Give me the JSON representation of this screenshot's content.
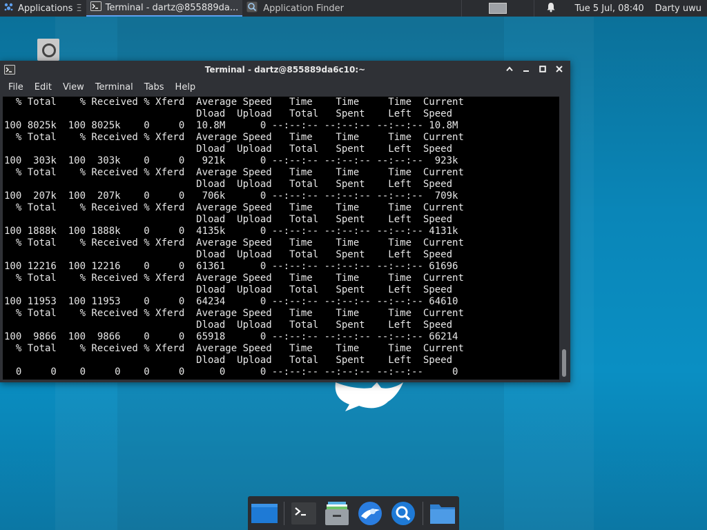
{
  "top_panel": {
    "applications_label": "Applications",
    "tasks": [
      {
        "label": "Terminal - dartz@855889da...",
        "active": true
      },
      {
        "label": "Application Finder",
        "active": false
      }
    ],
    "clock": "Tue  5 Jul, 08:40",
    "user": "Darty uwu"
  },
  "window": {
    "title": "Terminal - dartz@855889da6c10:~",
    "menus": [
      "File",
      "Edit",
      "View",
      "Terminal",
      "Tabs",
      "Help"
    ]
  },
  "terminal": {
    "lines": [
      "  % Total    % Received % Xferd  Average Speed   Time    Time     Time  Current",
      "                                 Dload  Upload   Total   Spent    Left  Speed",
      "100 8025k  100 8025k    0     0  10.8M      0 --:--:-- --:--:-- --:--:-- 10.8M",
      "  % Total    % Received % Xferd  Average Speed   Time    Time     Time  Current",
      "                                 Dload  Upload   Total   Spent    Left  Speed",
      "100  303k  100  303k    0     0   921k      0 --:--:-- --:--:-- --:--:--  923k",
      "  % Total    % Received % Xferd  Average Speed   Time    Time     Time  Current",
      "                                 Dload  Upload   Total   Spent    Left  Speed",
      "100  207k  100  207k    0     0   706k      0 --:--:-- --:--:-- --:--:--  709k",
      "  % Total    % Received % Xferd  Average Speed   Time    Time     Time  Current",
      "                                 Dload  Upload   Total   Spent    Left  Speed",
      "100 1888k  100 1888k    0     0  4135k      0 --:--:-- --:--:-- --:--:-- 4131k",
      "  % Total    % Received % Xferd  Average Speed   Time    Time     Time  Current",
      "                                 Dload  Upload   Total   Spent    Left  Speed",
      "100 12216  100 12216    0     0  61361      0 --:--:-- --:--:-- --:--:-- 61696",
      "  % Total    % Received % Xferd  Average Speed   Time    Time     Time  Current",
      "                                 Dload  Upload   Total   Spent    Left  Speed",
      "100 11953  100 11953    0     0  64234      0 --:--:-- --:--:-- --:--:-- 64610",
      "  % Total    % Received % Xferd  Average Speed   Time    Time     Time  Current",
      "                                 Dload  Upload   Total   Spent    Left  Speed",
      "100  9866  100  9866    0     0  65918      0 --:--:-- --:--:-- --:--:-- 66214",
      "  % Total    % Received % Xferd  Average Speed   Time    Time     Time  Current",
      "                                 Dload  Upload   Total   Spent    Left  Speed",
      "  0     0    0     0    0     0      0      0 --:--:-- --:--:-- --:--:--     0"
    ]
  },
  "dock": {
    "items": [
      {
        "icon": "show-desktop-icon"
      },
      {
        "icon": "terminal-icon"
      },
      {
        "icon": "file-manager-drawer-icon"
      },
      {
        "icon": "web-browser-icon"
      },
      {
        "icon": "app-finder-search-icon"
      },
      {
        "icon": "folder-icon"
      }
    ]
  },
  "colors": {
    "accent": "#5fa0ef",
    "desktop": "#0a8fc3",
    "panel": "#2b2d31",
    "terminal_bg": "#000000",
    "terminal_fg": "#e8e8e8"
  }
}
